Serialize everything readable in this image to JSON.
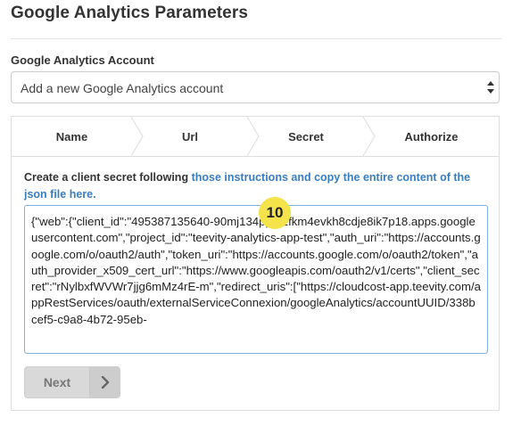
{
  "page": {
    "title": "Google Analytics Parameters"
  },
  "account": {
    "label": "Google Analytics Account",
    "selected": "Add a new Google Analytics account"
  },
  "steps": [
    {
      "label": "Name"
    },
    {
      "label": "Url"
    },
    {
      "label": "Secret"
    },
    {
      "label": "Authorize"
    }
  ],
  "instructions": {
    "prefix": "Create a client secret following ",
    "link": "those instructions and copy the entire content of the json file here."
  },
  "json_input": {
    "value": "{\"web\":{\"client_id\":\"495387135640-90mj134ppf52fkm4evkh8cdje8ik7p18.apps.googleusercontent.com\",\"project_id\":\"teevity-analytics-app-test\",\"auth_uri\":\"https://accounts.google.com/o/oauth2/auth\",\"token_uri\":\"https://accounts.google.com/o/oauth2/token\",\"auth_provider_x509_cert_url\":\"https://www.googleapis.com/oauth2/v1/certs\",\"client_secret\":\"rNylbxfWVWr7jjg6mMz4rE-m\",\"redirect_uris\":[\"https://cloudcost-app.teevity.com/appRestServices/oauth/externalServiceConnexion/googleAnalytics/accountUUID/338bcef5-c9a8-4b72-95eb-"
  },
  "badge": {
    "number": "10",
    "color": "#f4e34a"
  },
  "buttons": {
    "next_label": "Next"
  },
  "colors": {
    "link": "#3a7dbf",
    "input_focus_border": "#7fb0e0",
    "button_bg": "#d9d9d9"
  },
  "icons": {
    "select_arrows": "select-arrows-icon",
    "next_arrow": "chevron-right-icon"
  }
}
